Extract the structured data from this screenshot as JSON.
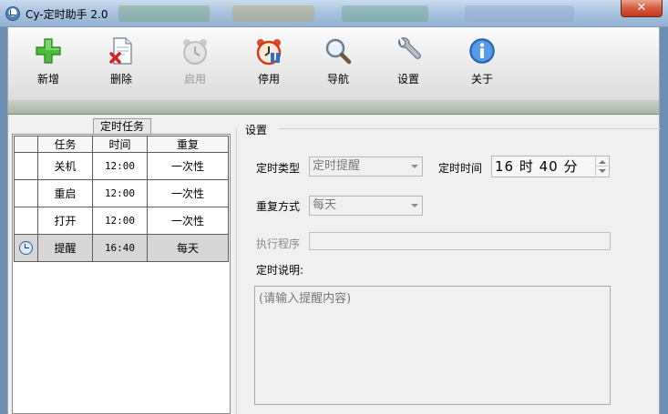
{
  "window": {
    "title": "Cy-定时助手 2.0",
    "close_label": "✕"
  },
  "toolbar": {
    "buttons": [
      {
        "label": "新增",
        "icon": "plus-icon",
        "enabled": true
      },
      {
        "label": "删除",
        "icon": "delete-document-icon",
        "enabled": true
      },
      {
        "label": "启用",
        "icon": "alarm-clock-icon",
        "enabled": false
      },
      {
        "label": "停用",
        "icon": "alarm-clock-stop-icon",
        "enabled": true
      },
      {
        "label": "导航",
        "icon": "magnifier-icon",
        "enabled": true
      },
      {
        "label": "设置",
        "icon": "wrench-icon",
        "enabled": true
      },
      {
        "label": "关于",
        "icon": "info-icon",
        "enabled": true
      }
    ]
  },
  "task_panel": {
    "tab_label": "定时任务",
    "columns": [
      "任务",
      "时间",
      "重复"
    ],
    "rows": [
      {
        "task": "关机",
        "time": "12:00",
        "repeat": "一次性",
        "icon": "",
        "selected": false
      },
      {
        "task": "重启",
        "time": "12:00",
        "repeat": "一次性",
        "icon": "",
        "selected": false
      },
      {
        "task": "打开",
        "time": "12:00",
        "repeat": "一次性",
        "icon": "",
        "selected": false
      },
      {
        "task": "提醒",
        "time": "16:40",
        "repeat": "每天",
        "icon": "clock-icon",
        "selected": true
      }
    ]
  },
  "settings": {
    "title": "设置",
    "type_label": "定时类型",
    "type_value": "定时提醒",
    "time_label": "定时时间",
    "time_value": "16 时 40 分",
    "repeat_label": "重复方式",
    "repeat_value": "每天",
    "program_label": "执行程序",
    "program_value": "",
    "desc_label": "定时说明:",
    "desc_value": "(请输入提醒内容)"
  }
}
